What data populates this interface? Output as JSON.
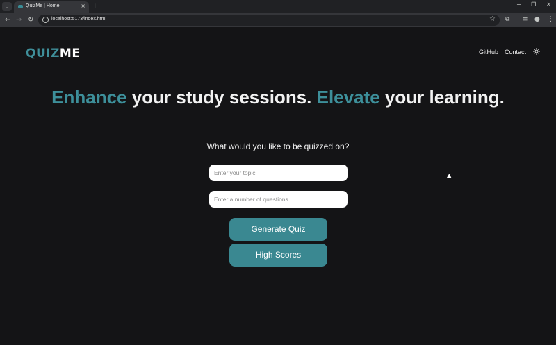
{
  "browser": {
    "tab_title": "QuizMe | Home",
    "tab_list_icon": "chevron-down-icon",
    "new_tab_symbol": "+",
    "url": "localhost:5173/index.html",
    "window_controls": [
      "−",
      "❐",
      "✕"
    ]
  },
  "header": {
    "logo_part1": "QUIZ",
    "logo_part2": "ME",
    "nav": [
      "GitHub",
      "Contact"
    ],
    "theme_icon": "sun-icon"
  },
  "hero": {
    "accent1": "Enhance",
    "text1": " your study sessions. ",
    "accent2": "Elevate",
    "text2": " your learning."
  },
  "form": {
    "prompt": "What would you like to be quizzed on?",
    "topic_placeholder": "Enter your topic",
    "count_placeholder": "Enter a number of questions",
    "generate_label": "Generate Quiz",
    "scores_label": "High Scores"
  },
  "colors": {
    "accent": "#3a8891",
    "background": "#141416"
  }
}
